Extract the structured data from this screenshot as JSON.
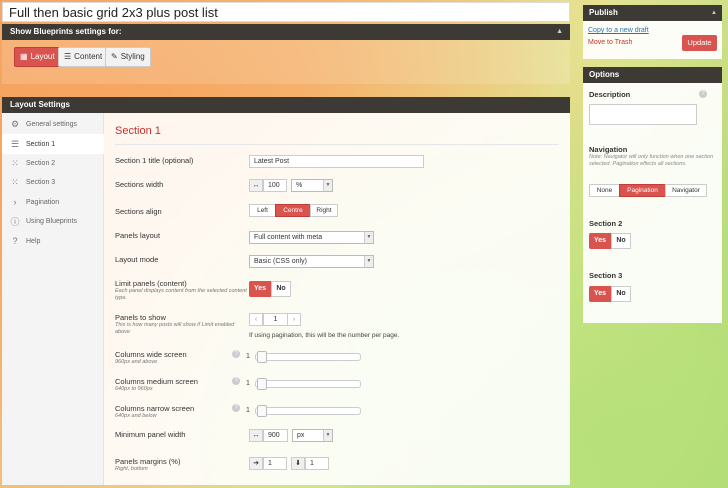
{
  "page": {
    "title": "Full then basic grid 2x3 plus post list"
  },
  "blueprint_bar": {
    "label": "Show Blueprints settings for:",
    "collapse_icon": "triangle-up-icon",
    "modes": [
      {
        "label": "Layout",
        "icon": "layout-icon",
        "active": true
      },
      {
        "label": "Content",
        "icon": "content-icon",
        "active": false
      },
      {
        "label": "Styling",
        "icon": "pencil-icon",
        "active": false
      }
    ]
  },
  "layout_settings": {
    "header": "Layout Settings",
    "sidebar": [
      {
        "label": "General settings",
        "icon": "sliders-icon",
        "active": false
      },
      {
        "label": "Section 1",
        "icon": "list-icon",
        "active": true
      },
      {
        "label": "Section 2",
        "icon": "grid-icon",
        "active": false
      },
      {
        "label": "Section 3",
        "icon": "grid-icon",
        "active": false
      },
      {
        "label": "Pagination",
        "icon": "chevron-right-icon",
        "active": false
      },
      {
        "label": "Using Blueprints",
        "icon": "info-icon",
        "active": false
      },
      {
        "label": "Help",
        "icon": "help-icon",
        "active": false
      }
    ]
  },
  "section": {
    "title": "Section 1",
    "title_field": {
      "label": "Section 1 title (optional)",
      "value": "Latest Post"
    },
    "width": {
      "label": "Sections width",
      "value": "100",
      "unit": "%"
    },
    "align": {
      "label": "Sections align",
      "options": [
        "Left",
        "Centre",
        "Right"
      ],
      "selected": "Centre"
    },
    "panels_layout": {
      "label": "Panels layout",
      "value": "Full content with meta"
    },
    "layout_mode": {
      "label": "Layout mode",
      "value": "Basic (CSS only)"
    },
    "limit_panels": {
      "label": "Limit panels (content)",
      "sub": "Each panel displays content from the selected content type.",
      "yes": "Yes",
      "no": "No",
      "value": "Yes"
    },
    "panels_to_show": {
      "label": "Panels to show",
      "sub": "This is how many posts will show if Limit enabled above",
      "value": "1",
      "note": "If using pagination, this will be the number per page."
    },
    "cols_wide": {
      "label": "Columns wide screen",
      "sub": "960px and above",
      "value": "1"
    },
    "cols_medium": {
      "label": "Columns medium screen",
      "sub": "640px to 960px",
      "value": "1"
    },
    "cols_narrow": {
      "label": "Columns narrow screen",
      "sub": "640px and below",
      "value": "1"
    },
    "min_width": {
      "label": "Minimum panel width",
      "value": "900",
      "unit": "px"
    },
    "margins": {
      "label": "Panels margins (%)",
      "sub": "Right, bottom",
      "right": "1",
      "bottom": "1"
    }
  },
  "publish": {
    "header": "Publish",
    "copy_link": "Copy to a new draft",
    "trash_link": "Move to Trash",
    "update_label": "Update"
  },
  "options": {
    "header": "Options",
    "description_label": "Description",
    "navigation_label": "Navigation",
    "navigation_note": "Note: Navigator will only function when one section selected. Pagination effects all sections.",
    "navigation_options": [
      "None",
      "Pagination",
      "Navigator"
    ],
    "navigation_selected": "Pagination",
    "section2_label": "Section 2",
    "section3_label": "Section 3",
    "yes": "Yes",
    "no": "No"
  },
  "colors": {
    "accent": "#d9534f",
    "bar": "#3d3a35",
    "section_title": "#c9302c",
    "link": "#2a74b5"
  }
}
